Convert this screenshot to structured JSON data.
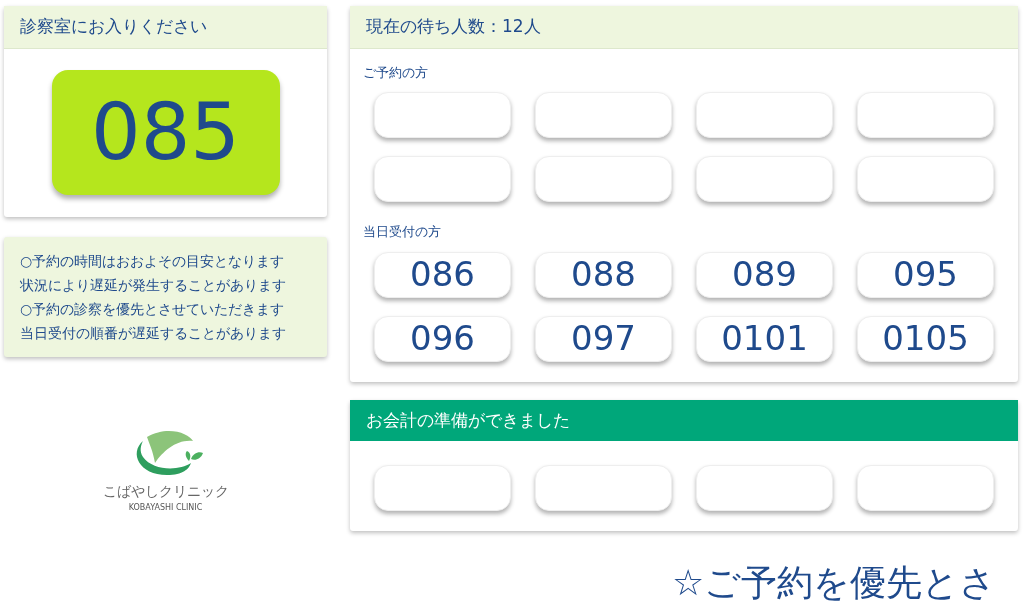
{
  "call_panel": {
    "title": "診察室にお入りください",
    "number": "085"
  },
  "notes": [
    "○予約の時間はおおよその目安となります",
    "状況により遅延が発生することがあります",
    "○予約の診察を優先とさせていただきます",
    "当日受付の順番が遅延することがあります"
  ],
  "logo": {
    "name": "こばやしクリニック",
    "name_en": "KOBAYASHI CLINIC"
  },
  "waiting_panel": {
    "title": "現在の待ち人数：12人",
    "sections": [
      {
        "label": "ご予約の方",
        "tickets": [
          {
            "kind": "empty"
          },
          {
            "kind": "empty"
          },
          {
            "kind": "empty"
          },
          {
            "kind": "empty"
          },
          {
            "kind": "empty"
          },
          {
            "kind": "empty"
          },
          {
            "kind": "empty"
          },
          {
            "kind": "empty"
          }
        ]
      },
      {
        "label": "当日受付の方",
        "tickets": [
          {
            "kind": "number",
            "number": "086"
          },
          {
            "kind": "number",
            "number": "088"
          },
          {
            "kind": "number",
            "number": "089"
          },
          {
            "kind": "number",
            "number": "095"
          },
          {
            "kind": "number",
            "number": "096"
          },
          {
            "kind": "number",
            "number": "097"
          },
          {
            "kind": "number",
            "number": "0101"
          },
          {
            "kind": "number",
            "number": "0105"
          }
        ]
      }
    ]
  },
  "checkout_panel": {
    "title": "お会計の準備ができました",
    "tickets": [
      {
        "kind": "empty"
      },
      {
        "kind": "empty"
      },
      {
        "kind": "empty"
      },
      {
        "kind": "empty"
      }
    ]
  },
  "ticker": "☆ご予約を優先とさ"
}
